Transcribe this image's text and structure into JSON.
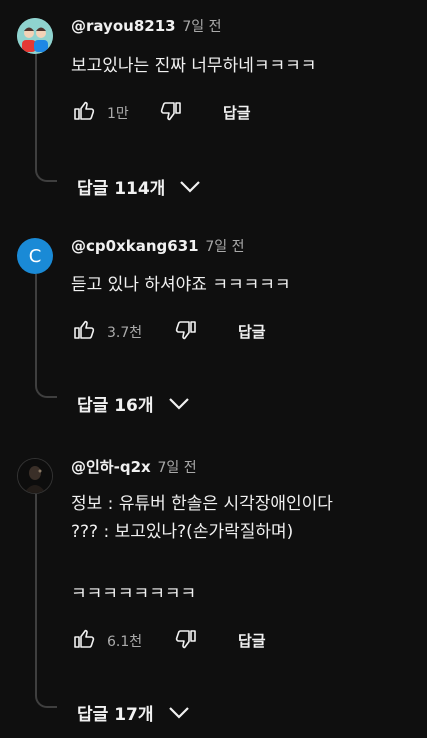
{
  "comments": [
    {
      "handle": "@rayou8213",
      "time": "7일 전",
      "avatar_icon": "illustrated-avatar",
      "lines": [
        "보고있나는 진짜 너무하네ㅋㅋㅋㅋ"
      ],
      "likes": "1만",
      "reply_label": "답글",
      "replies_label": "답글 114개"
    },
    {
      "handle": "@cp0xkang631",
      "time": "7일 전",
      "avatar_letter": "C",
      "lines": [
        "듣고 있나 하셔야죠 ㅋㅋㅋㅋㅋ"
      ],
      "likes": "3.7천",
      "reply_label": "답글",
      "replies_label": "답글 16개"
    },
    {
      "handle": "@인하-q2x",
      "time": "7일 전",
      "avatar_icon": "photo-avatar",
      "lines": [
        "정보 : 유튜버 한솔은 시각장애인이다",
        "??? : 보고있나?(손가락질하며)",
        "",
        "ㅋㅋㅋㅋㅋㅋㅋㅋ"
      ],
      "likes": "6.1천",
      "reply_label": "답글",
      "replies_label": "답글 17개"
    }
  ]
}
